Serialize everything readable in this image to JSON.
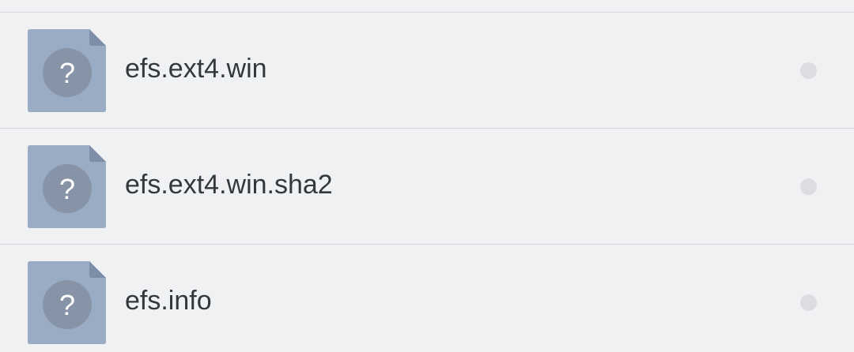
{
  "files": [
    {
      "name": "efs.ext4.win",
      "icon": "unknown-file-icon"
    },
    {
      "name": "efs.ext4.win.sha2",
      "icon": "unknown-file-icon"
    },
    {
      "name": "efs.info",
      "icon": "unknown-file-icon"
    }
  ],
  "icon_glyph": "?",
  "colors": {
    "background": "#f0f1f3",
    "divider": "#d6d7da",
    "file_icon": "#9aabc4",
    "file_icon_fold": "#7e8ea8",
    "file_icon_circle": "#8794a8",
    "file_icon_glyph": "#ffffff",
    "text": "#34373c",
    "select_dot": "#dcdde0"
  }
}
